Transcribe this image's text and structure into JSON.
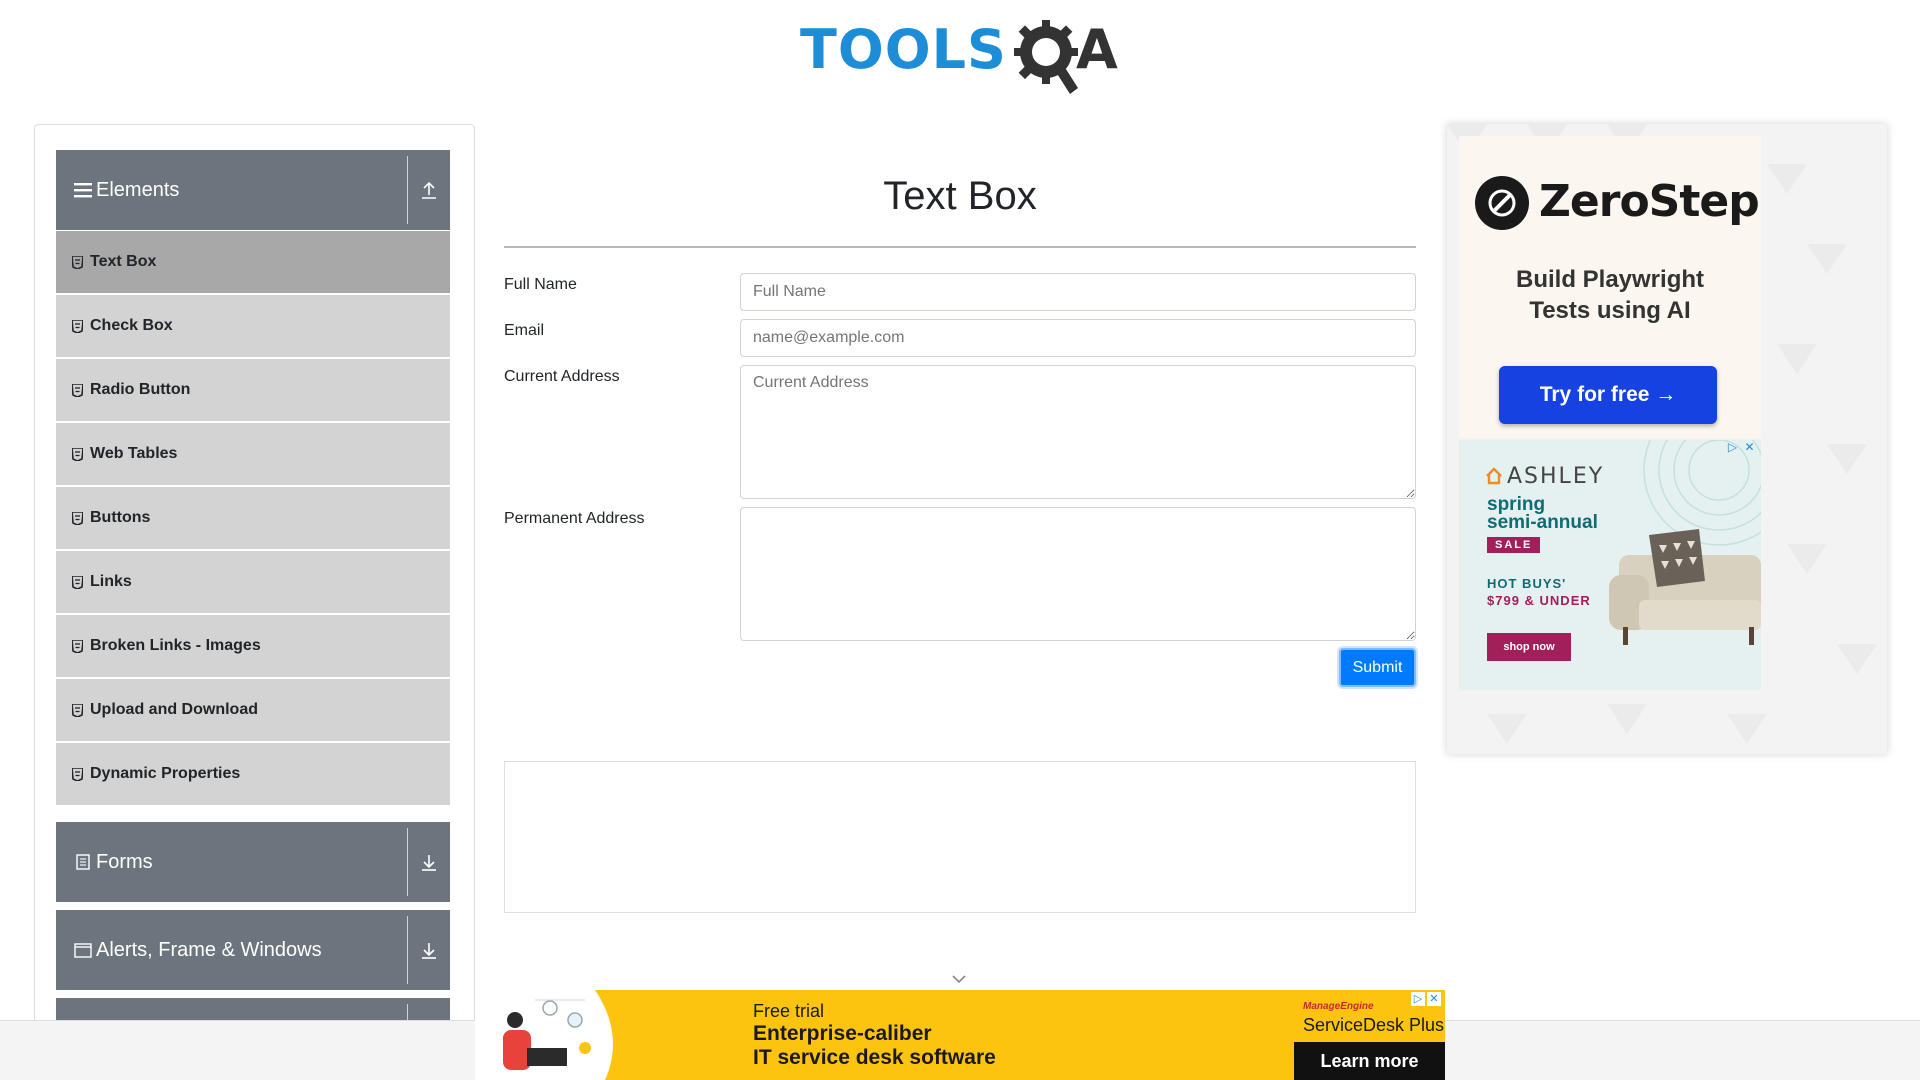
{
  "header": {
    "logo_text": "TOOLS",
    "logo_text_2": "A"
  },
  "sidebar": {
    "groups": [
      {
        "label": "Elements",
        "icon": "hamburger-icon",
        "arrow": "collapse-up-icon",
        "expanded": true
      },
      {
        "label": "Forms",
        "icon": "document-icon",
        "arrow": "expand-down-icon",
        "expanded": false
      },
      {
        "label": "Alerts, Frame & Windows",
        "icon": "window-icon",
        "arrow": "expand-down-icon",
        "expanded": false
      }
    ],
    "items": [
      {
        "label": "Text Box",
        "active": true
      },
      {
        "label": "Check Box",
        "active": false
      },
      {
        "label": "Radio Button",
        "active": false
      },
      {
        "label": "Web Tables",
        "active": false
      },
      {
        "label": "Buttons",
        "active": false
      },
      {
        "label": "Links",
        "active": false
      },
      {
        "label": "Broken Links - Images",
        "active": false
      },
      {
        "label": "Upload and Download",
        "active": false
      },
      {
        "label": "Dynamic Properties",
        "active": false
      }
    ]
  },
  "main": {
    "title": "Text Box",
    "fields": {
      "full_name": {
        "label": "Full Name",
        "placeholder": "Full Name",
        "value": ""
      },
      "email": {
        "label": "Email",
        "placeholder": "name@example.com",
        "value": ""
      },
      "current_address": {
        "label": "Current Address",
        "placeholder": "Current Address",
        "value": ""
      },
      "permanent_address": {
        "label": "Permanent Address",
        "placeholder": "",
        "value": ""
      }
    },
    "submit_label": "Submit"
  },
  "right_ad": {
    "zerostep": {
      "brand": "ZeroStep",
      "tagline_1": "Build Playwright",
      "tagline_2": "Tests using AI",
      "cta": "Try for free →"
    },
    "ashley": {
      "brand": "ASHLEY",
      "headline_1": "spring",
      "headline_2": "semi-annual",
      "sale": "SALE",
      "hot_buys": "HOT BUYS'",
      "price": "$799 & UNDER",
      "cta": "shop now"
    }
  },
  "bottom_ad": {
    "line1": "Free trial",
    "line2": "Enterprise-caliber",
    "line3": "IT service desk software",
    "brand_small": "ManageEngine",
    "brand": "ServiceDesk Plus",
    "cta": "Learn more"
  },
  "colors": {
    "sidebar_group_bg": "#6c757d",
    "menu_item_bg": "#d3d3d3",
    "menu_item_active_bg": "#a8a8a8",
    "primary_button": "#007bff",
    "logo_blue": "#1c8dd6",
    "ad_yellow": "#fdc40f"
  }
}
